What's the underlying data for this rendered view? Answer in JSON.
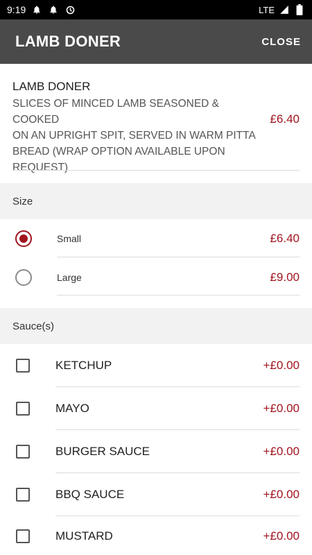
{
  "status_bar": {
    "time": "9:19",
    "network": "LTE",
    "icons": [
      "notification-bell-icon",
      "notification-bell-icon",
      "data-saver-icon",
      "signal-icon",
      "battery-icon"
    ]
  },
  "app_bar": {
    "title": "LAMB DONER",
    "close_label": "CLOSE"
  },
  "item": {
    "name": "LAMB DONER",
    "description_lines": [
      "SLICES OF MINCED LAMB SEASONED & COOKED",
      "ON AN UPRIGHT SPIT, SERVED IN WARM PITTA",
      "BREAD (WRAP OPTION AVAILABLE UPON",
      "REQUEST)"
    ],
    "price": "£6.40"
  },
  "size_section": {
    "header": "Size",
    "options": [
      {
        "label": "Small",
        "price": "£6.40",
        "selected": true
      },
      {
        "label": "Large",
        "price": "£9.00",
        "selected": false
      }
    ]
  },
  "sauce_section": {
    "header": "Sauce(s)",
    "options": [
      {
        "label": "KETCHUP",
        "price": "+£0.00",
        "checked": false
      },
      {
        "label": "MAYO",
        "price": "+£0.00",
        "checked": false
      },
      {
        "label": "BURGER SAUCE",
        "price": "+£0.00",
        "checked": false
      },
      {
        "label": "BBQ SAUCE",
        "price": "+£0.00",
        "checked": false
      },
      {
        "label": "MUSTARD",
        "price": "+£0.00",
        "checked": false
      }
    ]
  },
  "colors": {
    "accent": "#a0141e",
    "app_bar": "#4a4a4a",
    "section_bg": "#f2f2f2"
  }
}
